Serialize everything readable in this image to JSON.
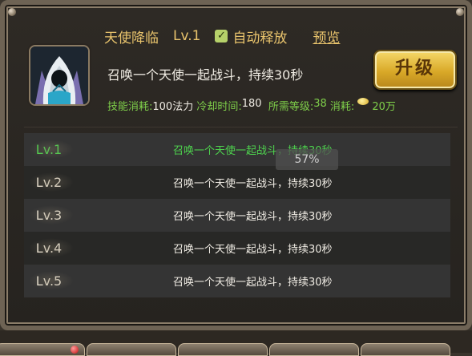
{
  "skill": {
    "name": "天使降临",
    "level": "Lv.1",
    "auto_cast_label": "自动释放",
    "auto_cast_checked": true,
    "preview_label": "预览",
    "description": "召唤一个天使一起战斗，持续30秒",
    "upgrade_label": "升级"
  },
  "stats": {
    "cost_label": "技能消耗:",
    "cost_value": "100法力",
    "cooldown_label": "冷却时间:",
    "cooldown_value": "180",
    "req_level_label": "所需等级:",
    "req_level_value": "38",
    "price_label": "消耗:",
    "price_value": "20万"
  },
  "levels": [
    {
      "level": "Lv.1",
      "text": "召唤一个天使一起战斗，持续30秒",
      "current": true
    },
    {
      "level": "Lv.2",
      "text": "召唤一个天使一起战斗，持续30秒",
      "current": false
    },
    {
      "level": "Lv.3",
      "text": "召唤一个天使一起战斗，持续30秒",
      "current": false
    },
    {
      "level": "Lv.4",
      "text": "召唤一个天使一起战斗，持续30秒",
      "current": false
    },
    {
      "level": "Lv.5",
      "text": "召唤一个天使一起战斗，持续30秒",
      "current": false
    }
  ],
  "overlay": {
    "progress_text": "57%"
  },
  "colors": {
    "accent_gold": "#e8c36c",
    "active_green": "#4ed34e",
    "label_green": "#7fcf4a"
  },
  "icons": {
    "skill": "hooded-angel-icon",
    "check": "check-icon",
    "gold": "gold-coin-icon"
  }
}
